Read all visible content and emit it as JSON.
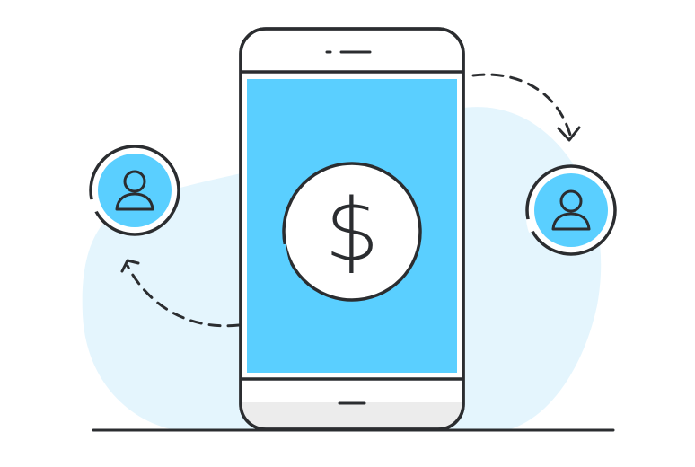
{
  "illustration": {
    "currency_symbol": "$",
    "icons": {
      "sender": "user-icon",
      "receiver": "user-icon",
      "phone": "smartphone-icon",
      "coin": "dollar-coin-icon",
      "arrow_out": "dashed-arrow-icon",
      "arrow_in": "dashed-arrow-icon"
    }
  },
  "colors": {
    "outline": "#2b2d30",
    "accent": "#5acfff",
    "blob": "#e4f5fd",
    "white": "#ffffff",
    "phone_chin": "#ececec"
  }
}
